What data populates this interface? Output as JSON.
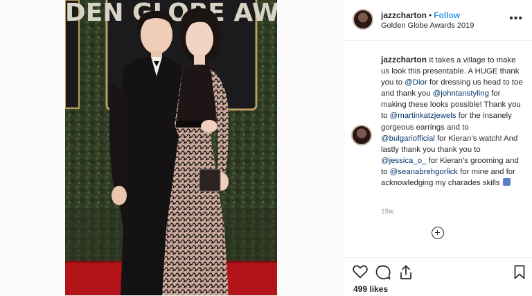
{
  "post": {
    "username": "jazzcharton",
    "separator": "•",
    "follow_label": "Follow",
    "location": "Golden Globe Awards 2019",
    "more_label": "•••",
    "caption": {
      "username": "jazzcharton",
      "t1": " It takes a village to make us look this presentable. A HUGE thank you to ",
      "m1": "@Dior",
      "t2": " for dressing us head to toe and thank you ",
      "m2": "@johntanstyling",
      "t3": " for making these looks possible! Thank you to ",
      "m3": "@martinkatzjewels",
      "t4": " for the insanely gorgeous earrings and to ",
      "m4": "@bulgariofficial",
      "t5": " for Kieran’s watch! And lastly thank you thank you to ",
      "m5": "@jessica_o_",
      "t6": " for Kieran’s grooming and to ",
      "m6": "@seanabrehgorlick",
      "t7": " for mine and for acknowledging my charades skills "
    },
    "time_ago": "19w",
    "likes": "499 likes"
  },
  "backdrop": {
    "sign_text": "GOLDEN GLOBE AWARDS"
  },
  "colors": {
    "link": "#3897f0",
    "mention": "#003569",
    "text": "#262626",
    "muted": "#999999",
    "carpet": "#b3141a",
    "hedge": "#2e3a24"
  },
  "icons": [
    "more-icon",
    "add-comment-icon",
    "heart-icon",
    "comment-icon",
    "share-icon",
    "bookmark-icon"
  ]
}
